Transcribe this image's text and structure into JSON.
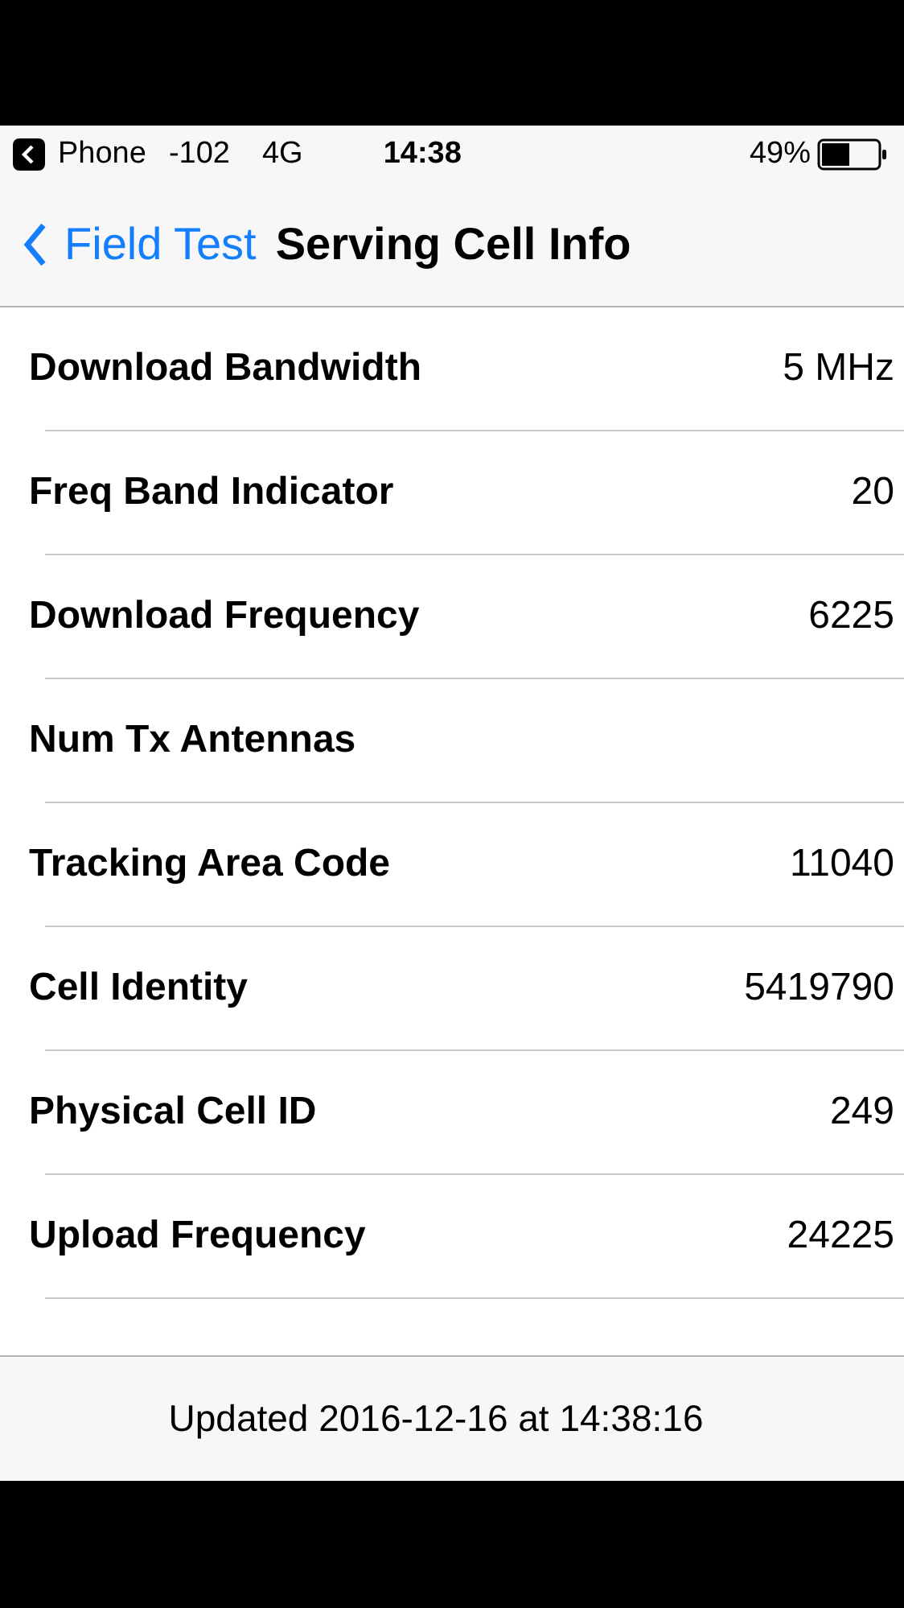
{
  "status_bar": {
    "back_app": "Phone",
    "signal": "-102",
    "network": "4G",
    "time": "14:38",
    "battery": "49%"
  },
  "nav": {
    "back": "Field Test",
    "title": "Serving Cell Info"
  },
  "rows": [
    {
      "label": "Download Bandwidth",
      "value": "5 MHz"
    },
    {
      "label": "Freq Band Indicator",
      "value": "20"
    },
    {
      "label": "Download Frequency",
      "value": "6225"
    },
    {
      "label": "Num Tx Antennas"
    },
    {
      "label": "Tracking Area Code",
      "value": "11040"
    },
    {
      "label": "Cell Identity",
      "value": "5419790"
    },
    {
      "label": "Physical Cell ID",
      "value": "249"
    },
    {
      "label": "Upload Frequency",
      "value": "24225"
    }
  ],
  "toolbar": {
    "updated": "Updated 2016-12-16 at 14:38:16"
  }
}
